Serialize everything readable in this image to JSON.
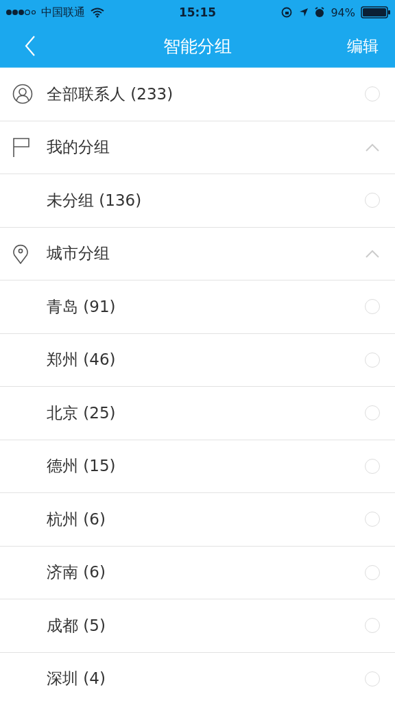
{
  "status_bar": {
    "carrier": "中国联通",
    "time": "15:15",
    "battery": "94%"
  },
  "nav": {
    "title": "智能分组",
    "action": "编辑"
  },
  "list": [
    {
      "kind": "item",
      "label": "全部联系人 (233)",
      "selected": false
    },
    {
      "kind": "section",
      "label": "我的分组",
      "expanded": true,
      "children": [
        {
          "kind": "item",
          "label": "未分组 (136)",
          "selected": false
        }
      ]
    },
    {
      "kind": "section",
      "label": "城市分组",
      "expanded": true,
      "children": [
        {
          "kind": "item",
          "label": "青岛 (91)",
          "selected": false
        },
        {
          "kind": "item",
          "label": "郑州 (46)",
          "selected": false
        },
        {
          "kind": "item",
          "label": "北京 (25)",
          "selected": false
        },
        {
          "kind": "item",
          "label": "德州 (15)",
          "selected": false
        },
        {
          "kind": "item",
          "label": "杭州 (6)",
          "selected": false
        },
        {
          "kind": "item",
          "label": "济南 (6)",
          "selected": false
        },
        {
          "kind": "item",
          "label": "成都 (5)",
          "selected": false
        },
        {
          "kind": "item",
          "label": "深圳 (4)",
          "selected": false
        }
      ]
    }
  ]
}
